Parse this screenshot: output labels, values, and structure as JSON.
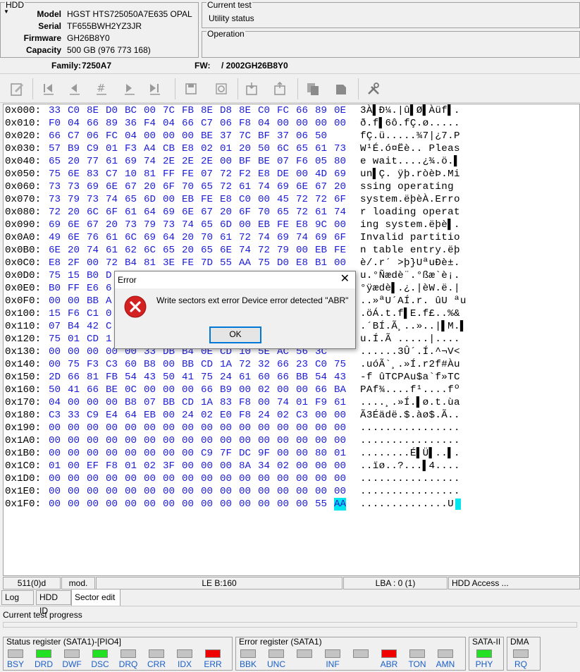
{
  "hdd": {
    "title": "HDD",
    "fields": [
      {
        "label": "Model",
        "value": "HGST HTS725050A7E635  OPAL"
      },
      {
        "label": "Serial",
        "value": "TF655BWH2YZ3JR"
      },
      {
        "label": "Firmware",
        "value": "GH26B8Y0"
      },
      {
        "label": "Capacity",
        "value": "500 GB (976 773 168)"
      }
    ]
  },
  "current_test": {
    "title": "Current test",
    "value": "Utility status"
  },
  "operation": {
    "title": "Operation"
  },
  "family": {
    "label": "Family:",
    "value": "7250A7",
    "fw_label": "FW:",
    "fw_value": "/ 2002GH26B8Y0"
  },
  "hex": {
    "rows": [
      {
        "off": "0x000:",
        "bytes": [
          "33",
          "C0",
          "8E",
          "D0",
          "BC",
          "00",
          "7C",
          "FB",
          "8E",
          "D8",
          "8E",
          "C0",
          "FC",
          "66",
          "89",
          "0E"
        ],
        "ascii": "3À▌Ð¼.|û▌Ø▌Àüf▌."
      },
      {
        "off": "0x010:",
        "bytes": [
          "F0",
          "04",
          "66",
          "89",
          "36",
          "F4",
          "04",
          "66",
          "C7",
          "06",
          "F8",
          "04",
          "00",
          "00",
          "00",
          "00"
        ],
        "ascii": "ð.f▌6ô.fÇ.ø....."
      },
      {
        "off": "0x020:",
        "bytes": [
          "66",
          "C7",
          "06",
          "FC",
          "04",
          "00",
          "00",
          "00",
          "BE",
          "37",
          "7C",
          "BF",
          "37",
          "06",
          "50"
        ],
        "ascii": "fÇ.ü.....¾7|¿7.P"
      },
      {
        "off": "0x030:",
        "bytes": [
          "57",
          "B9",
          "C9",
          "01",
          "F3",
          "A4",
          "CB",
          "E8",
          "02",
          "01",
          "20",
          "50",
          "6C",
          "65",
          "61",
          "73"
        ],
        "ascii": "W¹É.ó¤Ëè.. Pleas"
      },
      {
        "off": "0x040:",
        "bytes": [
          "65",
          "20",
          "77",
          "61",
          "69",
          "74",
          "2E",
          "2E",
          "2E",
          "00",
          "BF",
          "BE",
          "07",
          "F6",
          "05",
          "80"
        ],
        "ascii": "e wait....¿¾.ö.▌"
      },
      {
        "off": "0x050:",
        "bytes": [
          "75",
          "6E",
          "83",
          "C7",
          "10",
          "81",
          "FF",
          "FE",
          "07",
          "72",
          "F2",
          "E8",
          "DE",
          "00",
          "4D",
          "69"
        ],
        "ascii": "un▌Ç. ÿþ.ròèÞ.Mi"
      },
      {
        "off": "0x060:",
        "bytes": [
          "73",
          "73",
          "69",
          "6E",
          "67",
          "20",
          "6F",
          "70",
          "65",
          "72",
          "61",
          "74",
          "69",
          "6E",
          "67",
          "20"
        ],
        "ascii": "ssing operating "
      },
      {
        "off": "0x070:",
        "bytes": [
          "73",
          "79",
          "73",
          "74",
          "65",
          "6D",
          "00",
          "EB",
          "FE",
          "E8",
          "C0",
          "00",
          "45",
          "72",
          "72",
          "6F"
        ],
        "ascii": "system.ëþèÀ.Erro"
      },
      {
        "off": "0x080:",
        "bytes": [
          "72",
          "20",
          "6C",
          "6F",
          "61",
          "64",
          "69",
          "6E",
          "67",
          "20",
          "6F",
          "70",
          "65",
          "72",
          "61",
          "74"
        ],
        "ascii": "r loading operat"
      },
      {
        "off": "0x090:",
        "bytes": [
          "69",
          "6E",
          "67",
          "20",
          "73",
          "79",
          "73",
          "74",
          "65",
          "6D",
          "00",
          "EB",
          "FE",
          "E8",
          "9C",
          "00"
        ],
        "ascii": "ing system.ëþè▌."
      },
      {
        "off": "0x0A0:",
        "bytes": [
          "49",
          "6E",
          "76",
          "61",
          "6C",
          "69",
          "64",
          "20",
          "70",
          "61",
          "72",
          "74",
          "69",
          "74",
          "69",
          "6F"
        ],
        "ascii": "Invalid partitio"
      },
      {
        "off": "0x0B0:",
        "bytes": [
          "6E",
          "20",
          "74",
          "61",
          "62",
          "6C",
          "65",
          "20",
          "65",
          "6E",
          "74",
          "72",
          "79",
          "00",
          "EB",
          "FE"
        ],
        "ascii": "n table entry.ëþ"
      },
      {
        "off": "0x0C0:",
        "bytes": [
          "E8",
          "2F",
          "00",
          "72",
          "B4",
          "81",
          "3E",
          "FE",
          "7D",
          "55",
          "AA",
          "75",
          "D0",
          "E8",
          "B1",
          "00"
        ],
        "ascii": "è/.r´ >þ}UªuÐè±."
      },
      {
        "off": "0x0D0:",
        "bytes": [
          "75",
          "15",
          "B0",
          "D",
          "",
          "",
          "",
          "",
          "",
          "",
          "",
          "",
          "",
          "",
          "",
          ""
        ],
        "ascii": "u.°Ñædè¨.°ßæ`è¡."
      },
      {
        "off": "0x0E0:",
        "bytes": [
          "B0",
          "FF",
          "E6",
          "6",
          "",
          "",
          "",
          "",
          "",
          "",
          "",
          "",
          "",
          "",
          "",
          ""
        ],
        "ascii": "°ÿædè▌.¿.|èW.ë.|"
      },
      {
        "off": "0x0F0:",
        "bytes": [
          "00",
          "00",
          "BB",
          "A",
          "",
          "",
          "",
          "",
          "",
          "",
          "",
          "",
          "",
          "",
          "",
          ""
        ],
        "ascii": "..»ªU´AÍ.r. ûU ªu"
      },
      {
        "off": "0x100:",
        "bytes": [
          "15",
          "F6",
          "C1",
          "0",
          "",
          "",
          "",
          "",
          "",
          "",
          "",
          "",
          "",
          "",
          "",
          ""
        ],
        "ascii": ".öÁ.t.f▌E.f£..%&"
      },
      {
        "off": "0x110:",
        "bytes": [
          "07",
          "B4",
          "42",
          "C",
          "",
          "",
          "",
          "",
          "",
          "",
          "",
          "",
          "",
          "",
          "",
          ""
        ],
        "ascii": ".´BÍ.Ã¸..»..|▌M.▌"
      },
      {
        "off": "0x120:",
        "bytes": [
          "75",
          "01",
          "CD",
          "1",
          "",
          "",
          "",
          "",
          "",
          "",
          "",
          "",
          "",
          "",
          "",
          ""
        ],
        "ascii": "u.Í.Ã .....|...."
      },
      {
        "off": "0x130:",
        "bytes": [
          "00",
          "00",
          "00",
          "00",
          "00",
          "33",
          "DB",
          "B4",
          "0E",
          "CD",
          "10",
          "5E",
          "AC",
          "56",
          "3C"
        ],
        "ascii": "......3Û´.Í.^¬V<"
      },
      {
        "off": "0x140:",
        "bytes": [
          "00",
          "75",
          "F3",
          "C3",
          "60",
          "B8",
          "00",
          "BB",
          "CD",
          "1A",
          "72",
          "32",
          "66",
          "23",
          "C0",
          "75"
        ],
        "ascii": ".uóÃ`¸.»Í.r2f#Àu"
      },
      {
        "off": "0x150:",
        "bytes": [
          "2D",
          "66",
          "81",
          "FB",
          "54",
          "43",
          "50",
          "41",
          "75",
          "24",
          "61",
          "60",
          "66",
          "BB",
          "54",
          "43"
        ],
        "ascii": "-f ûTCPAu$a`f»TC"
      },
      {
        "off": "0x160:",
        "bytes": [
          "50",
          "41",
          "66",
          "BE",
          "0C",
          "00",
          "00",
          "00",
          "66",
          "B9",
          "00",
          "02",
          "00",
          "00",
          "66",
          "BA"
        ],
        "ascii": "PAf¾....f¹....fº"
      },
      {
        "off": "0x170:",
        "bytes": [
          "04",
          "00",
          "00",
          "00",
          "B8",
          "07",
          "BB",
          "CD",
          "1A",
          "83",
          "F8",
          "00",
          "74",
          "01",
          "F9",
          "61"
        ],
        "ascii": "....¸.»Í.▌ø.t.ùa"
      },
      {
        "off": "0x180:",
        "bytes": [
          "C3",
          "33",
          "C9",
          "E4",
          "64",
          "EB",
          "00",
          "24",
          "02",
          "E0",
          "F8",
          "24",
          "02",
          "C3",
          "00",
          "00"
        ],
        "ascii": "Ã3Éädë.$.àø$.Ã.."
      },
      {
        "off": "0x190:",
        "bytes": [
          "00",
          "00",
          "00",
          "00",
          "00",
          "00",
          "00",
          "00",
          "00",
          "00",
          "00",
          "00",
          "00",
          "00",
          "00",
          "00"
        ],
        "ascii": "................"
      },
      {
        "off": "0x1A0:",
        "bytes": [
          "00",
          "00",
          "00",
          "00",
          "00",
          "00",
          "00",
          "00",
          "00",
          "00",
          "00",
          "00",
          "00",
          "00",
          "00",
          "00"
        ],
        "ascii": "................"
      },
      {
        "off": "0x1B0:",
        "bytes": [
          "00",
          "00",
          "00",
          "00",
          "00",
          "00",
          "00",
          "00",
          "C9",
          "7F",
          "DC",
          "9F",
          "00",
          "00",
          "80",
          "01"
        ],
        "ascii": "........É▌Ü▌..▌."
      },
      {
        "off": "0x1C0:",
        "bytes": [
          "01",
          "00",
          "EF",
          "F8",
          "01",
          "02",
          "3F",
          "00",
          "00",
          "00",
          "8A",
          "34",
          "02",
          "00",
          "00",
          "00"
        ],
        "ascii": "..ïø..?...▌4...."
      },
      {
        "off": "0x1D0:",
        "bytes": [
          "00",
          "00",
          "00",
          "00",
          "00",
          "00",
          "00",
          "00",
          "00",
          "00",
          "00",
          "00",
          "00",
          "00",
          "00",
          "00"
        ],
        "ascii": "................"
      },
      {
        "off": "0x1E0:",
        "bytes": [
          "00",
          "00",
          "00",
          "00",
          "00",
          "00",
          "00",
          "00",
          "00",
          "00",
          "00",
          "00",
          "00",
          "00",
          "00",
          "00"
        ],
        "ascii": "................"
      },
      {
        "off": "0x1F0:",
        "bytes": [
          "00",
          "00",
          "00",
          "00",
          "00",
          "00",
          "00",
          "00",
          "00",
          "00",
          "00",
          "00",
          "00",
          "00",
          "55",
          "AA"
        ],
        "ascii": "..............U"
      }
    ],
    "highlight_byte": "AA"
  },
  "statusbar": {
    "sector": "511(0)d",
    "mode": "mod.",
    "le": "LE B:160",
    "lba": "LBA : 0 (1)",
    "access": "HDD Access ..."
  },
  "tabs": [
    {
      "label": "Log"
    },
    {
      "label": "HDD ID"
    },
    {
      "label": "Sector edit"
    }
  ],
  "progress": {
    "title": "Current test progress"
  },
  "status_register": {
    "title": "Status register (SATA1)-[PIO4]",
    "flags": [
      {
        "name": "BSY",
        "state": "off"
      },
      {
        "name": "DRD",
        "state": "green"
      },
      {
        "name": "DWF",
        "state": "off"
      },
      {
        "name": "DSC",
        "state": "green"
      },
      {
        "name": "DRQ",
        "state": "off"
      },
      {
        "name": "CRR",
        "state": "off"
      },
      {
        "name": "IDX",
        "state": "off"
      },
      {
        "name": "ERR",
        "state": "red"
      }
    ]
  },
  "error_register": {
    "title": "Error register (SATA1)",
    "flags": [
      {
        "name": "BBK",
        "state": "off"
      },
      {
        "name": "UNC",
        "state": "off"
      },
      {
        "name": "",
        "state": "off"
      },
      {
        "name": "INF",
        "state": "off"
      },
      {
        "name": "",
        "state": "off"
      },
      {
        "name": "ABR",
        "state": "red"
      },
      {
        "name": "TON",
        "state": "off"
      },
      {
        "name": "AMN",
        "state": "off"
      }
    ]
  },
  "sata": {
    "title": "SATA-II",
    "flag": "PHY",
    "state": "green"
  },
  "dma": {
    "title": "DMA",
    "flag": "RQ",
    "state": "off"
  },
  "dialog": {
    "title": "Error",
    "message": "Write sectors ext error Device error detected \"ABR\"",
    "ok_label": "OK"
  },
  "colors": {
    "hex_bytes": "#1c1cd8",
    "highlight": "#00e5ee",
    "led_green": "#22e022",
    "led_red": "#f00000"
  }
}
